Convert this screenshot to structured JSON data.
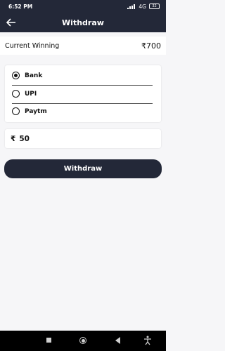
{
  "status": {
    "time": "6:52 PM",
    "network": "4G",
    "battery": "32"
  },
  "app_bar": {
    "title": "Withdraw"
  },
  "winning": {
    "label": "Current Winning",
    "amount": "₹700"
  },
  "options": [
    {
      "label": "Bank",
      "selected": true
    },
    {
      "label": "UPI",
      "selected": false
    },
    {
      "label": "Paytm",
      "selected": false
    }
  ],
  "amount_input": {
    "currency": "₹",
    "value": "50"
  },
  "withdraw_button": {
    "label": "Withdraw"
  },
  "colors": {
    "header": "#232838",
    "button": "#232838",
    "background": "#f6f6f8"
  }
}
